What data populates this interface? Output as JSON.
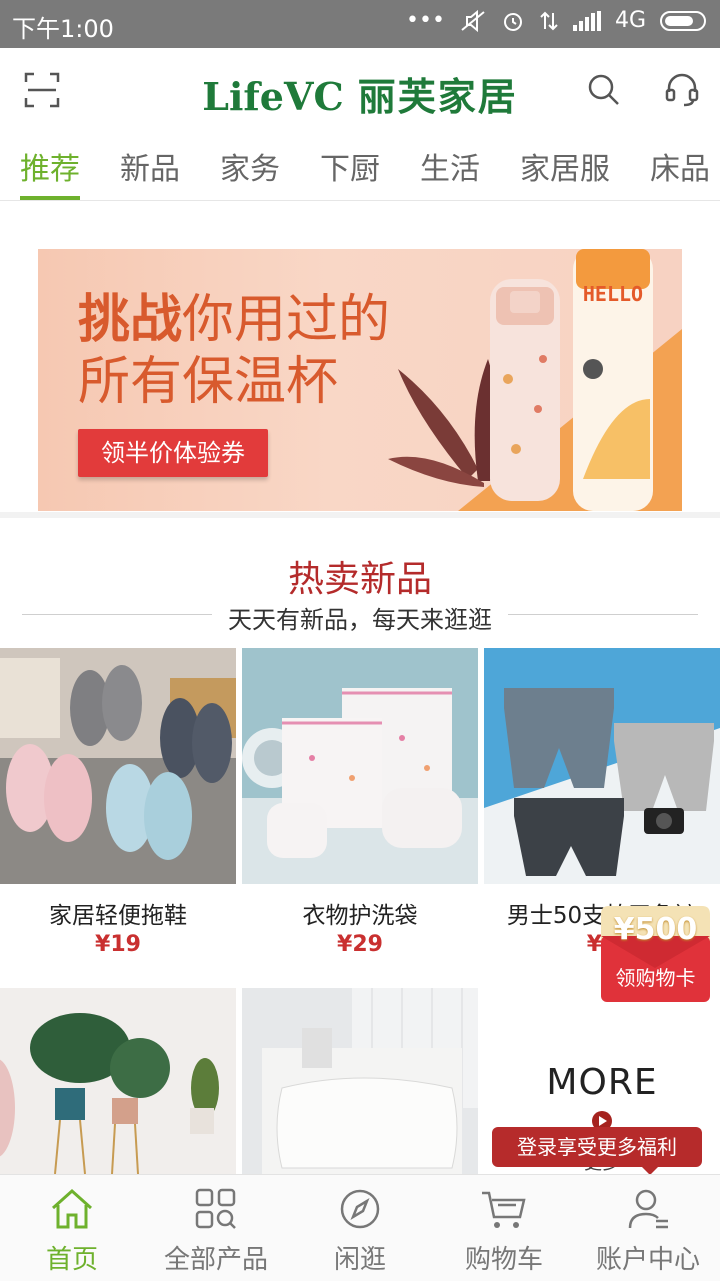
{
  "status_bar": {
    "time": "下午1:00",
    "network": "4G"
  },
  "header": {
    "logo_en": "LifeVC",
    "logo_cn": "丽芙家居",
    "scan_icon": "scan-icon",
    "search_icon": "search-icon",
    "service_icon": "headset-icon"
  },
  "tabs": [
    "推荐",
    "新品",
    "家务",
    "下厨",
    "生活",
    "家居服",
    "床品"
  ],
  "banner": {
    "line1_bold": "挑战",
    "line1_rest": "你用过的",
    "line2": "所有保温杯",
    "coupon_button": "领半价体验券",
    "bottle_text": "HELLO"
  },
  "section": {
    "title": "热卖新品",
    "subtitle": "天天有新品，每天来逛逛"
  },
  "products": [
    {
      "name": "家居轻便拖鞋",
      "price": "¥19"
    },
    {
      "name": "衣物护洗袋",
      "price": "¥29"
    },
    {
      "name": "男士50支棉平角裤",
      "price": "¥6"
    }
  ],
  "more": {
    "label": "MORE",
    "partial_text": "更多"
  },
  "promo_badge": {
    "amount": "¥500",
    "label": "领购物卡"
  },
  "login_tip": "登录享受更多福利",
  "bottom_nav": [
    {
      "label": "首页",
      "icon": "home-icon"
    },
    {
      "label": "全部产品",
      "icon": "grid-icon"
    },
    {
      "label": "闲逛",
      "icon": "compass-icon"
    },
    {
      "label": "购物车",
      "icon": "cart-icon"
    },
    {
      "label": "账户中心",
      "icon": "user-icon"
    }
  ],
  "colors": {
    "accent": "#6eb12d",
    "brand": "#1f7a3a",
    "price": "#c93030"
  }
}
